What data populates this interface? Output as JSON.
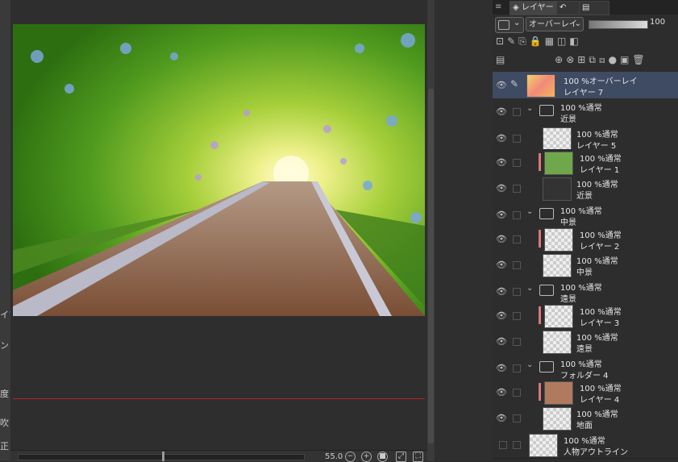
{
  "left_panel": {
    "stubs": [
      "イフ",
      "ンド",
      "度",
      "吹",
      "正"
    ]
  },
  "canvas": {
    "zoom": "55.0"
  },
  "panel": {
    "menu_icon": "≡",
    "tabs": [
      {
        "label": "レイヤー",
        "icon": "layers-icon"
      },
      {
        "label": "",
        "icon": "history-icon"
      },
      {
        "label": "",
        "icon": "navigator-icon"
      }
    ],
    "blend_mode": "オーバーレイ",
    "opacity": "100"
  },
  "layers": [
    {
      "line1": "100 %オーバーレイ",
      "line2": "レイヤー 7",
      "type": "layer",
      "selected": true
    },
    {
      "line1": "100 %通常",
      "line2": "近景",
      "type": "folder"
    },
    {
      "line1": "100 %通常",
      "line2": "レイヤー 5",
      "type": "layer"
    },
    {
      "line1": "100 %通常",
      "line2": "レイヤー 1",
      "type": "layer",
      "clipped": true
    },
    {
      "line1": "100 %通常",
      "line2": "近景",
      "type": "layer"
    },
    {
      "line1": "100 %通常",
      "line2": "中景",
      "type": "folder"
    },
    {
      "line1": "100 %通常",
      "line2": "レイヤー 2",
      "type": "layer",
      "clipped": true
    },
    {
      "line1": "100 %通常",
      "line2": "中景",
      "type": "layer"
    },
    {
      "line1": "100 %通常",
      "line2": "遠景",
      "type": "folder"
    },
    {
      "line1": "100 %通常",
      "line2": "レイヤー 3",
      "type": "layer",
      "clipped": true
    },
    {
      "line1": "100 %通常",
      "line2": "遠景",
      "type": "layer"
    },
    {
      "line1": "100 %通常",
      "line2": "フォルダー 4",
      "type": "folder"
    },
    {
      "line1": "100 %通常",
      "line2": "レイヤー 4",
      "type": "layer",
      "clipped": true
    },
    {
      "line1": "100 %通常",
      "line2": "地面",
      "type": "layer"
    },
    {
      "line1": "100 %通常",
      "line2": "人物アウトライン",
      "type": "layer"
    }
  ]
}
